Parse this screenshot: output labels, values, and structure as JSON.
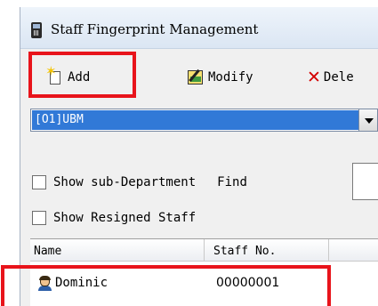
{
  "window": {
    "title": "Staff Fingerprint Management"
  },
  "toolbar": {
    "add_label": "Add",
    "modify_label": "Modify",
    "delete_label": "Dele"
  },
  "department": {
    "selected": "[O1]UBM"
  },
  "options": {
    "show_sub_department_label": "Show sub-Department",
    "find_label": "Find",
    "show_resigned_label": "Show Resigned Staff"
  },
  "grid": {
    "columns": [
      "Name",
      "Staff No."
    ],
    "rows": [
      {
        "name": "Dominic",
        "staff_no": "00000001"
      }
    ]
  },
  "colors": {
    "highlight": "#e8141b",
    "selection": "#3179d7"
  },
  "icons": {
    "app": "fingerprint-device-icon",
    "add": "new-page-icon",
    "modify": "edit-icon",
    "delete": "red-x-icon",
    "staff": "person-icon"
  }
}
